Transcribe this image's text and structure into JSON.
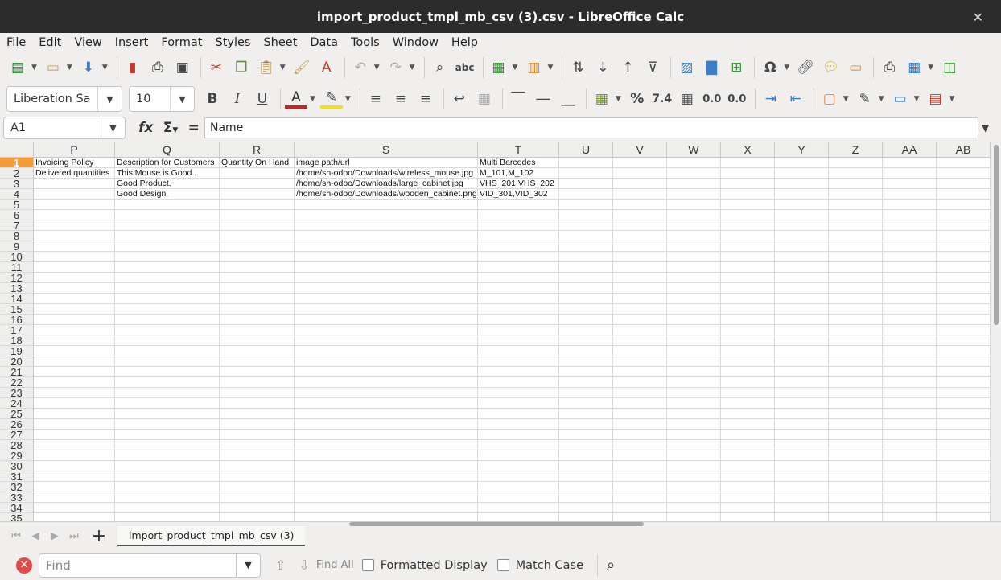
{
  "window": {
    "title": "import_product_tmpl_mb_csv (3).csv - LibreOffice Calc",
    "close_glyph": "✕"
  },
  "menu": [
    "File",
    "Edit",
    "View",
    "Insert",
    "Format",
    "Styles",
    "Sheet",
    "Data",
    "Tools",
    "Window",
    "Help"
  ],
  "format_toolbar": {
    "font_name": "Liberation Sa",
    "font_size": "10"
  },
  "formula_bar": {
    "cell_ref": "A1",
    "content": "Name"
  },
  "columns": [
    "P",
    "Q",
    "R",
    "S",
    "T",
    "U",
    "V",
    "W",
    "X",
    "Y",
    "Z",
    "AA",
    "AB"
  ],
  "rows": [
    "1",
    "2",
    "3",
    "4",
    "5",
    "6",
    "7",
    "8",
    "9",
    "10",
    "11",
    "12",
    "13",
    "14",
    "15",
    "16",
    "17",
    "18",
    "19",
    "20",
    "21",
    "22",
    "23",
    "24",
    "25",
    "26",
    "27",
    "28",
    "29",
    "30",
    "31",
    "32",
    "33",
    "34",
    "35"
  ],
  "cells": [
    [
      "Invoicing Policy",
      "Description for Customers",
      "Quantity On Hand",
      "image path/url",
      "Multi Barcodes"
    ],
    [
      "Delivered quantities",
      "This Mouse is Good .",
      "",
      "/home/sh-odoo/Downloads/wireless_mouse.jpg",
      "M_101,M_102"
    ],
    [
      "",
      "Good Product.",
      "",
      "/home/sh-odoo/Downloads/large_cabinet.jpg",
      "VHS_201,VHS_202"
    ],
    [
      "",
      "Good Design.",
      "",
      "/home/sh-odoo/Downloads/wooden_cabinet.png",
      "VID_301,VID_302"
    ]
  ],
  "sheet_tab": "import_product_tmpl_mb_csv (3)",
  "find_bar": {
    "placeholder": "Find",
    "find_all": "Find All",
    "formatted_display": "Formatted Display",
    "match_case": "Match Case"
  },
  "colors": {
    "active_row_header": "#f39c3c",
    "titlebar": "#2c2c2c"
  }
}
